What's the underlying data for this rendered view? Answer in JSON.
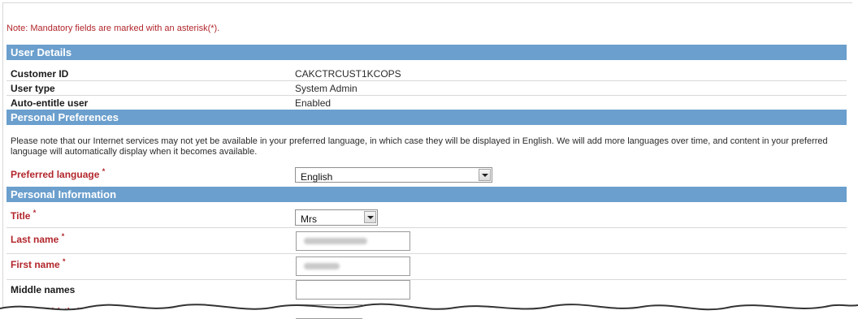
{
  "note": "Note: Mandatory fields are marked with an asterisk(*).",
  "sections": {
    "user_details": "User Details",
    "personal_preferences": "Personal Preferences",
    "personal_information": "Personal Information"
  },
  "user_details": {
    "customer_id_label": "Customer ID",
    "customer_id_value": "CAKCTRCUST1KCOPS",
    "user_type_label": "User type",
    "user_type_value": "System Admin",
    "auto_entitle_label": "Auto-entitle user",
    "auto_entitle_value": "Enabled"
  },
  "preferences": {
    "info": "Please note that our Internet services may not yet be available in your preferred language, in which case they will be displayed in English. We will add more languages over time, and content in your preferred language will automatically display when it becomes available.",
    "language_label": "Preferred language",
    "language_value": "English"
  },
  "personal": {
    "title_label": "Title",
    "title_value": "Mrs",
    "last_name_label": "Last name",
    "first_name_label": "First name",
    "middle_names_label": "Middle names",
    "dob_label": "ate of birth (dd/m"
  },
  "asterisk": "*",
  "icons": {
    "calendar": "calendar-icon",
    "dropdown": "chevron-down-icon"
  },
  "colors": {
    "section_bg": "#6b9fcd",
    "required_red": "#b2262c"
  }
}
